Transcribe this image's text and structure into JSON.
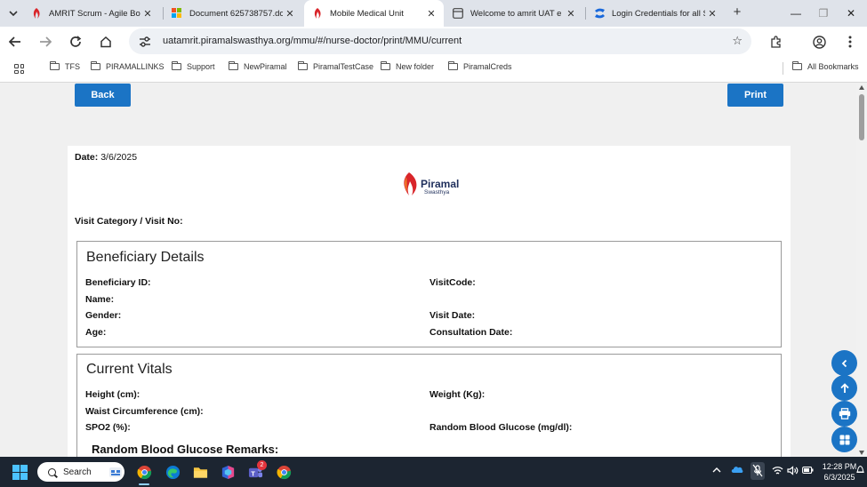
{
  "browser": {
    "tabs": [
      {
        "label": "AMRIT Scrum - Agile Boa",
        "icon": "piramal-flame-icon",
        "active": false
      },
      {
        "label": "Document 625738757.do",
        "icon": "document-grid-icon",
        "active": false
      },
      {
        "label": "Mobile Medical Unit",
        "icon": "piramal-flame-icon",
        "active": true
      },
      {
        "label": "Welcome to amrit UAT e",
        "icon": "webpage-icon",
        "active": false
      },
      {
        "label": "Login Credentials for all S",
        "icon": "confluence-icon",
        "active": false
      }
    ],
    "close_glyph": "✕",
    "new_tab_glyph": "+",
    "window_controls": [
      "—",
      "❐",
      "✕"
    ],
    "url": "uatamrit.piramalswasthya.org/mmu/#/nurse-doctor/print/MMU/current",
    "bookmarks": [
      "TFS",
      "PIRAMALLINKS",
      "Support",
      "NewPiramal",
      "PiramalTestCase",
      "New folder",
      "PiramalCreds"
    ],
    "all_bookmarks": "All Bookmarks"
  },
  "page": {
    "back_label": "Back",
    "print_label": "Print",
    "date_label": "Date:",
    "date_value": "3/6/2025",
    "logo_name": "Piramal",
    "logo_sub": "Swasthya",
    "visit_category_label": "Visit Category / Visit No:",
    "beneficiary": {
      "title": "Beneficiary Details",
      "beneficiary_id": "Beneficiary ID:",
      "name": "Name:",
      "gender": "Gender:",
      "age": "Age:",
      "visit_code": "VisitCode:",
      "visit_date": "Visit Date:",
      "consultation_date": "Consultation Date:"
    },
    "vitals": {
      "title": "Current Vitals",
      "height": "Height (cm):",
      "waist": "Waist Circumference (cm):",
      "spo2": "SPO2 (%):",
      "weight": "Weight (Kg):",
      "rbg": "Random Blood Glucose (mg/dl):",
      "rbg_remarks": "Random Blood Glucose Remarks:"
    }
  },
  "fabs": [
    "chevron-left-icon",
    "arrow-up-icon",
    "printer-icon",
    "grid-icon"
  ],
  "taskbar": {
    "search_label": "Search",
    "teams_badge": "2",
    "time": "12:28 PM",
    "date": "6/3/2025"
  },
  "colors": {
    "primary_button": "#1b74c5",
    "brand_red": "#d9252a",
    "tab_strip": "#dfe3ea",
    "taskbar": "#1c2531"
  }
}
